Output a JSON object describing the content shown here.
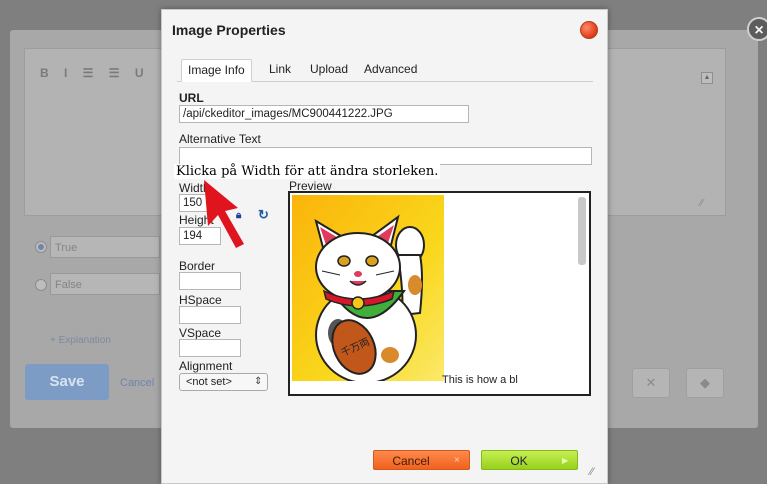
{
  "background": {
    "toolbar_text": "B I ☰ ☰ U",
    "options": [
      "True",
      "False"
    ],
    "explanation_link": "+ Explanation",
    "save_label": "Save",
    "cancel_label": "Cancel",
    "close_glyph": "×"
  },
  "dialog": {
    "title": "Image Properties",
    "tabs": [
      "Image Info",
      "Link",
      "Upload",
      "Advanced"
    ],
    "active_tab": "Image Info",
    "url_label": "URL",
    "url_value": "/api/ckeditor_images/MC900441222.JPG",
    "alt_label": "Alternative Text",
    "alt_value": "",
    "annotation": "Klicka på Width för att ändra storleken.",
    "width_label": "Width",
    "width_value": "150",
    "height_label": "Height",
    "height_value": "194",
    "border_label": "Border",
    "hspace_label": "HSpace",
    "vspace_label": "VSpace",
    "alignment_label": "Alignment",
    "alignment_value": "<not set>",
    "preview_label": "Preview",
    "preview_text": "This is how a bl",
    "cancel_label": "Cancel",
    "ok_label": "OK"
  },
  "colors": {
    "cancel_button": "#f0611d",
    "ok_button": "#97d11c",
    "close_button": "#e2451f",
    "annotation_arrow": "#e0141e"
  }
}
